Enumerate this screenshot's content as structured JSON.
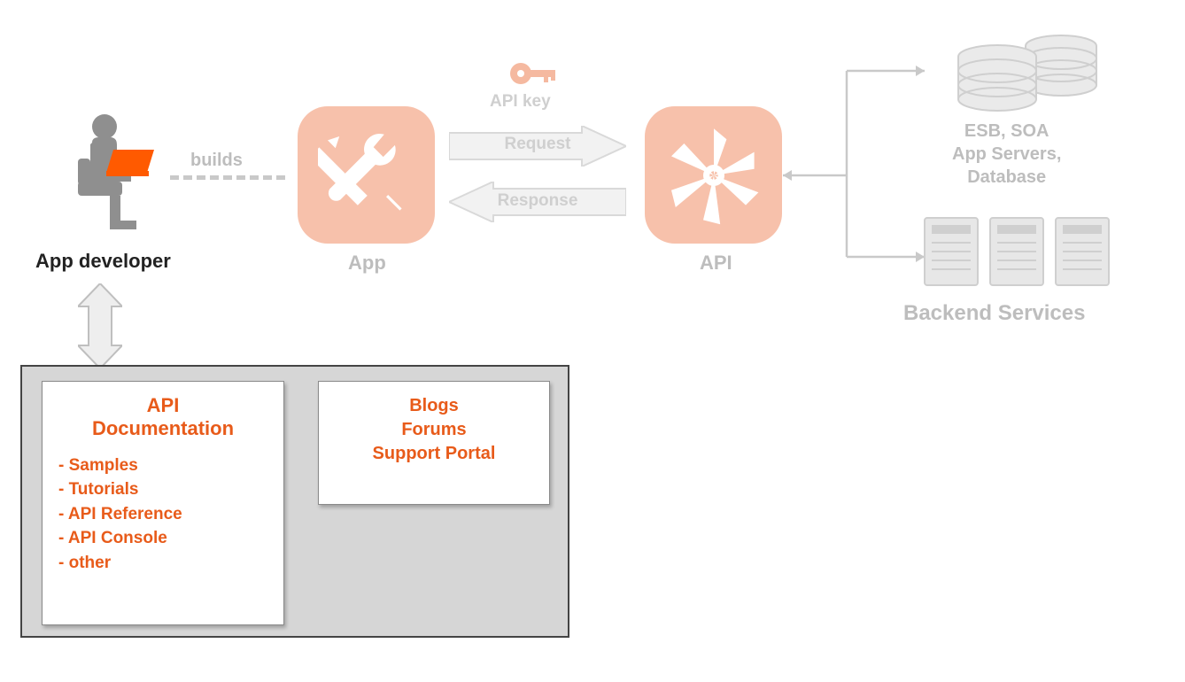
{
  "developer": {
    "label": "App developer"
  },
  "builds": {
    "label": "builds"
  },
  "app": {
    "label": "App"
  },
  "api": {
    "label": "API"
  },
  "apiKey": {
    "label": "API key"
  },
  "flow": {
    "request": "Request",
    "response": "Response"
  },
  "backend": {
    "title": "Backend Services",
    "desc_line1": "ESB, SOA",
    "desc_line2": "App Servers,",
    "desc_line3": "Database"
  },
  "portal": {
    "docs": {
      "title_line1": "API",
      "title_line2": "Documentation",
      "items": [
        "- Samples",
        "- Tutorials",
        "- API Reference",
        "- API Console",
        "- other"
      ]
    },
    "community": {
      "line1": "Blogs",
      "line2": "Forums",
      "line3": "Support Portal"
    }
  }
}
